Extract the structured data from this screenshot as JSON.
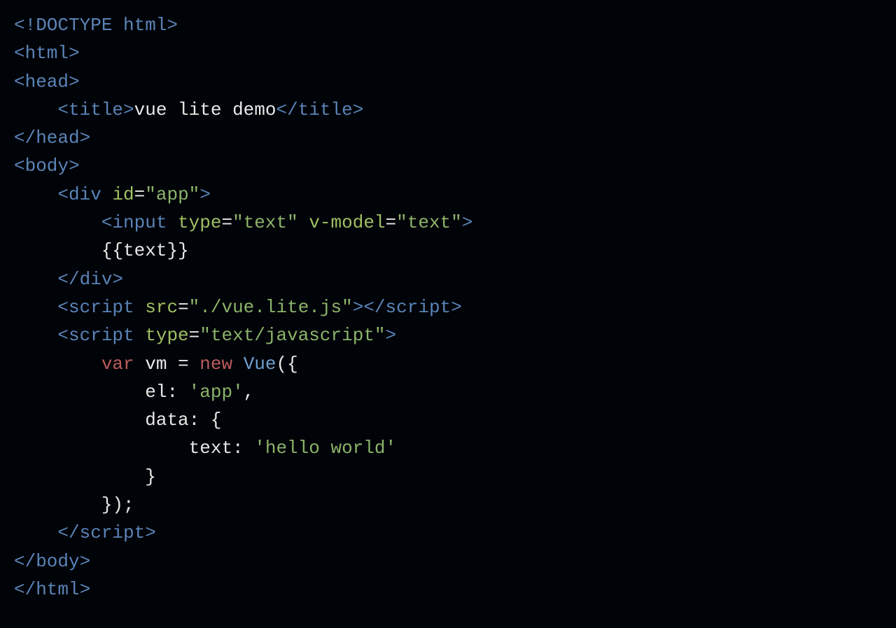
{
  "code": {
    "line01": {
      "doctype": "<!DOCTYPE html>"
    },
    "line02": {
      "open_html": "<html>"
    },
    "line03": {
      "open_head": "<head>"
    },
    "line04": {
      "open_title": "<title>",
      "title_text": "vue lite demo",
      "close_title": "</title>"
    },
    "line05": {
      "close_head": "</head>"
    },
    "line06": {
      "open_body": "<body>"
    },
    "line07": {
      "open_div": "<div ",
      "attr_id": "id",
      "eq": "=",
      "val_app": "\"app\"",
      "close_gt": ">"
    },
    "line08": {
      "open_input": "<input ",
      "attr_type": "type",
      "val_text": "\"text\"",
      "attr_vmodel": "v-model",
      "val_text2": "\"text\"",
      "close_gt": ">"
    },
    "line09": {
      "mustache": "{{text}}"
    },
    "line10": {
      "close_div": "</div>"
    },
    "line11": {
      "open_script": "<script ",
      "attr_src": "src",
      "val_src": "\"./vue.lite.js\"",
      "close_gt": ">",
      "close_script": "</script>"
    },
    "line12": {
      "open_script": "<script ",
      "attr_type": "type",
      "val_type": "\"text/javascript\"",
      "close_gt": ">"
    },
    "line13": {
      "kw_var": "var",
      "vm": " vm ",
      "eq": "= ",
      "kw_new": "new",
      "vue": " Vue",
      "paren": "({"
    },
    "line14": {
      "el_key": "el: ",
      "el_val": "'app'",
      "comma": ","
    },
    "line15": {
      "data_key": "data: {"
    },
    "line16": {
      "text_key": "text: ",
      "text_val": "'hello world'"
    },
    "line17": {
      "close_brace": "}"
    },
    "line18": {
      "close_paren": "});"
    },
    "line19": {
      "close_script": "</script>"
    },
    "line20": {
      "close_body": "</body>"
    },
    "line21": {
      "close_html": "</html>"
    }
  }
}
